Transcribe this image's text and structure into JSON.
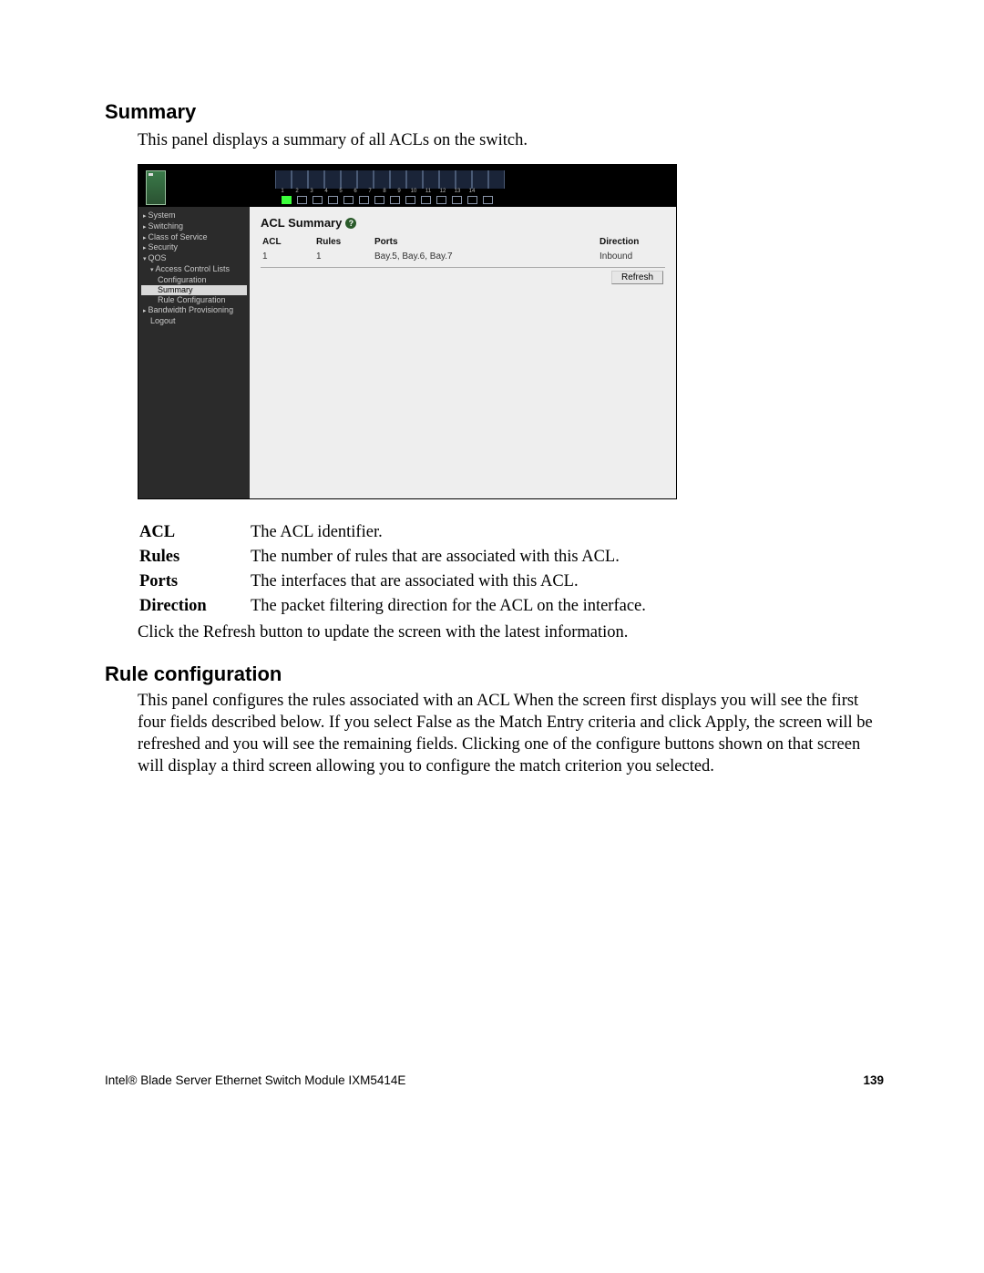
{
  "headings": {
    "summary": "Summary",
    "rule_config": "Rule configuration"
  },
  "summary_intro": "This panel displays a summary of all ACLs on the switch.",
  "screenshot": {
    "port_numbers": [
      "1",
      "2",
      "3",
      "4",
      "5",
      "6",
      "7",
      "8",
      "9",
      "10",
      "11",
      "12",
      "13",
      "14"
    ],
    "nav": {
      "system": "System",
      "switching": "Switching",
      "cos": "Class of Service",
      "security": "Security",
      "qos": "QOS",
      "acl": "Access Control Lists",
      "configuration": "Configuration",
      "summary": "Summary",
      "rule_config": "Rule Configuration",
      "bandwidth": "Bandwidth Provisioning",
      "logout": "Logout"
    },
    "panel_title": "ACL Summary",
    "help_glyph": "?",
    "table": {
      "headers": {
        "acl": "ACL",
        "rules": "Rules",
        "ports": "Ports",
        "direction": "Direction"
      },
      "row": {
        "acl": "1",
        "rules": "1",
        "ports": "Bay.5, Bay.6, Bay.7",
        "direction": "Inbound"
      }
    },
    "refresh_label": "Refresh"
  },
  "definitions": {
    "acl_term": "ACL",
    "acl_def": "The ACL identifier.",
    "rules_term": "Rules",
    "rules_def": "The number of rules that are associated with this ACL.",
    "ports_term": "Ports",
    "ports_def": "The interfaces that are associated with this ACL.",
    "direction_term": "Direction",
    "direction_def": "The packet filtering direction for the ACL on the interface."
  },
  "refresh_note": "Click the Refresh button to update the screen with the latest information.",
  "rule_config_body": "This panel configures the rules associated with an ACL When the screen first displays you will see the first four fields described below. If you select False as the Match Entry criteria and click Apply, the screen will be refreshed and you will see the remaining fields. Clicking one of the configure buttons shown on that screen will display a third screen allowing you to configure the match criterion you selected.",
  "footer": {
    "product": "Intel® Blade Server Ethernet Switch Module IXM5414E",
    "page": "139"
  }
}
